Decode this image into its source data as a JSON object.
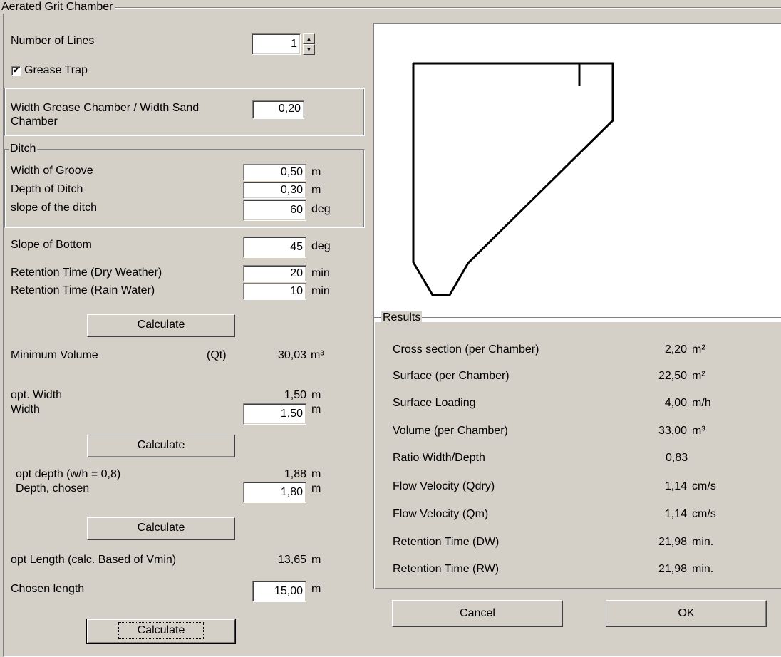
{
  "window": {
    "group_title": "Aerated Grit Chamber"
  },
  "lines": {
    "label": "Number of Lines",
    "value": "1"
  },
  "grease_trap": {
    "label": "Grease Trap",
    "checked_glyph": "✔"
  },
  "grease_ratio": {
    "label_line1": "Width Grease Chamber / Width Sand",
    "label_line2": "Chamber",
    "value": "0,20"
  },
  "ditch": {
    "title": "Ditch",
    "rows": [
      {
        "label": "Width of Groove",
        "value": "0,50",
        "unit": "m"
      },
      {
        "label": "Depth of Ditch",
        "value": "0,30",
        "unit": "m"
      },
      {
        "label": "slope of the ditch",
        "value": "60",
        "unit": "deg"
      }
    ]
  },
  "slope_bottom": {
    "label": "Slope of Bottom",
    "value": "45",
    "unit": "deg"
  },
  "retention": [
    {
      "label": "Retention Time (Dry Weather)",
      "value": "20",
      "unit": "min"
    },
    {
      "label": "Retention Time (Rain Water)",
      "value": "10",
      "unit": "min"
    }
  ],
  "buttons": {
    "calculate": "Calculate",
    "cancel": "Cancel",
    "ok": "OK"
  },
  "min_volume": {
    "label": "Minimum Volume",
    "flow": "(Qt)",
    "value": "30,03",
    "unit": "m³"
  },
  "width": {
    "opt_label": "opt. Width",
    "opt_value": "1,50",
    "opt_unit": "m",
    "label": "Width",
    "value": "1,50",
    "unit": "m"
  },
  "depth": {
    "opt_label": "opt depth (w/h = 0,8)",
    "opt_value": "1,88",
    "opt_unit": "m",
    "label": "Depth, chosen",
    "value": "1,80",
    "unit": "m"
  },
  "length": {
    "opt_label": "opt Length (calc. Based of Vmin)",
    "opt_value": "13,65",
    "opt_unit": "m",
    "label": "Chosen length",
    "value": "15,00",
    "unit": "m"
  },
  "results": {
    "title": "Results",
    "rows": [
      {
        "label": "Cross section (per Chamber)",
        "value": "2,20",
        "unit": "m²"
      },
      {
        "label": "Surface (per Chamber)",
        "value": "22,50",
        "unit": "m²"
      },
      {
        "label": "Surface Loading",
        "value": "4,00",
        "unit": "m/h"
      },
      {
        "label": "Volume (per Chamber)",
        "value": "33,00",
        "unit": "m³"
      },
      {
        "label": "Ratio Width/Depth",
        "value": "0,83",
        "unit": ""
      },
      {
        "label": "Flow Velocity (Qdry)",
        "value": "1,14",
        "unit": "cm/s"
      },
      {
        "label": "Flow Velocity (Qm)",
        "value": "1,14",
        "unit": "cm/s"
      },
      {
        "label": "Retention Time (DW)",
        "value": "21,98",
        "unit": "min."
      },
      {
        "label": "Retention Time (RW)",
        "value": "21,98",
        "unit": "min."
      }
    ]
  }
}
